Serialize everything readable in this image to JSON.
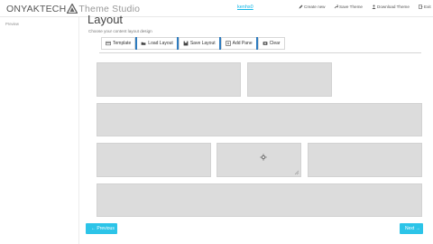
{
  "brand": {
    "name_left": "ONYAKTECH",
    "name_right": "Theme Studio"
  },
  "header": {
    "link": "kenhs0",
    "nav": [
      {
        "label": "Create new",
        "icon": "pencil-icon"
      },
      {
        "label": "Save Theme",
        "icon": "wrench-icon"
      },
      {
        "label": "Download Theme",
        "icon": "user-icon"
      },
      {
        "label": "Exit",
        "icon": "exit-icon"
      }
    ]
  },
  "sidebar": {
    "items": [
      {
        "label": "Preview"
      }
    ]
  },
  "main": {
    "title": "Layout",
    "subtitle": "Choose your content layout design",
    "toolbar": [
      {
        "label": "Template",
        "icon": "template-icon"
      },
      {
        "label": "Load Layout",
        "icon": "folder-open-icon"
      },
      {
        "label": "Save Layout",
        "icon": "save-icon"
      },
      {
        "label": "Add Pane",
        "icon": "add-pane-icon"
      },
      {
        "label": "Clear",
        "icon": "eraser-icon"
      }
    ]
  },
  "footer": {
    "previous": "← Previous",
    "next": "Next →"
  },
  "colors": {
    "accent": "#2cc4e8",
    "link": "#12b6e6",
    "pane": "#dcdcdc"
  }
}
